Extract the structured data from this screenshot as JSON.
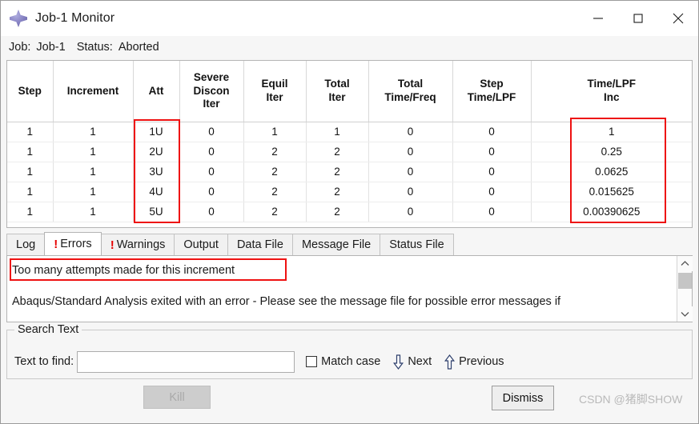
{
  "window": {
    "title": "Job-1 Monitor",
    "icon": "abaqus-diamond-icon",
    "minimize_label": "—",
    "maximize_label": "□",
    "close_label": "✕"
  },
  "status": {
    "job_label": "Job:",
    "job_value": "Job-1",
    "status_label": "Status:",
    "status_value": "Aborted"
  },
  "table": {
    "columns": [
      "Step",
      "Increment",
      "Att",
      "Severe\nDiscon\nIter",
      "Equil\nIter",
      "Total\nIter",
      "Total\nTime/Freq",
      "Step\nTime/LPF",
      "Time/LPF\nInc"
    ],
    "columns_display": [
      "Step",
      "Increment",
      "Att",
      "Severe Discon Iter",
      "Equil Iter",
      "Total Iter",
      "Total Time/Freq",
      "Step Time/LPF",
      "Time/LPF Inc"
    ],
    "rows": [
      [
        "1",
        "1",
        "1U",
        "0",
        "1",
        "1",
        "0",
        "0",
        "1"
      ],
      [
        "1",
        "1",
        "2U",
        "0",
        "2",
        "2",
        "0",
        "0",
        "0.25"
      ],
      [
        "1",
        "1",
        "3U",
        "0",
        "2",
        "2",
        "0",
        "0",
        "0.0625"
      ],
      [
        "1",
        "1",
        "4U",
        "0",
        "2",
        "2",
        "0",
        "0",
        "0.015625"
      ],
      [
        "1",
        "1",
        "5U",
        "0",
        "2",
        "2",
        "0",
        "0",
        "0.00390625"
      ]
    ]
  },
  "annotations": {
    "color": "#ee1111",
    "boxes": [
      "att-column-highlight",
      "time-lpf-inc-column-highlight",
      "error-message-highlight"
    ]
  },
  "tabs": [
    {
      "label": "Log",
      "warn": false,
      "active": false
    },
    {
      "label": "Errors",
      "warn": true,
      "active": true
    },
    {
      "label": "Warnings",
      "warn": true,
      "active": false
    },
    {
      "label": "Output",
      "warn": false,
      "active": false
    },
    {
      "label": "Data File",
      "warn": false,
      "active": false
    },
    {
      "label": "Message File",
      "warn": false,
      "active": false
    },
    {
      "label": "Status File",
      "warn": false,
      "active": false
    }
  ],
  "tab_warn_glyph": "!",
  "messages": {
    "line1": "Too many attempts made for this increment",
    "line2": "Abaqus/Standard Analysis exited with an error - Please see the  message file for possible error messages if"
  },
  "scrollbar": {
    "up_glyph": "⌃",
    "down_glyph": "⌄"
  },
  "search": {
    "legend": "Search Text",
    "find_label": "Text to find:",
    "find_value": "",
    "find_placeholder": "",
    "match_case_label": "Match case",
    "match_case_checked": false,
    "next_label": "Next",
    "previous_label": "Previous"
  },
  "footer": {
    "kill_label": "Kill",
    "kill_disabled": true,
    "dismiss_label": "Dismiss",
    "watermark": "CSDN @猪脚SHOW"
  }
}
